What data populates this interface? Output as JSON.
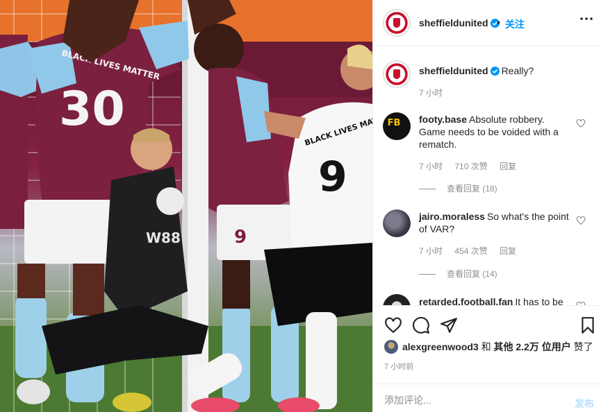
{
  "photo": {
    "jersey_back": "BLACK LIVES MATTER",
    "number_left": "30",
    "number_right": "9",
    "sponsor": "W88"
  },
  "header": {
    "username": "sheffieldunited",
    "separator": "•",
    "follow_label": "关注"
  },
  "caption": {
    "username": "sheffieldunited",
    "text": "Really?",
    "time": "7 小时"
  },
  "comments": [
    {
      "username": "footy.base",
      "text": "Absolute robbery. Game needs to be voided with a rematch.",
      "time": "7 小时",
      "likes": "710 次赞",
      "reply_label": "回复",
      "view_replies": "查看回复 (18)"
    },
    {
      "username": "jairo.moraless",
      "text": "So what's the point of VAR?",
      "time": "7 小时",
      "likes": "454 次赞",
      "reply_label": "回复",
      "view_replies": "查看回复 (14)"
    },
    {
      "username": "retarded.football.fan",
      "text": "It has to be"
    }
  ],
  "likes_row": {
    "user": "alexgreenwood3",
    "conj": "和",
    "others": "其他 2.2万 位用户",
    "suffix": "赞了"
  },
  "post_time": "7 小时前",
  "add_comment": {
    "placeholder": "添加评论...",
    "post_label": "发布"
  },
  "colors": {
    "accent": "#0095f6",
    "post_disabled": "#b2dffc",
    "muted": "#8e8e8e",
    "club_red": "#c8102e"
  }
}
